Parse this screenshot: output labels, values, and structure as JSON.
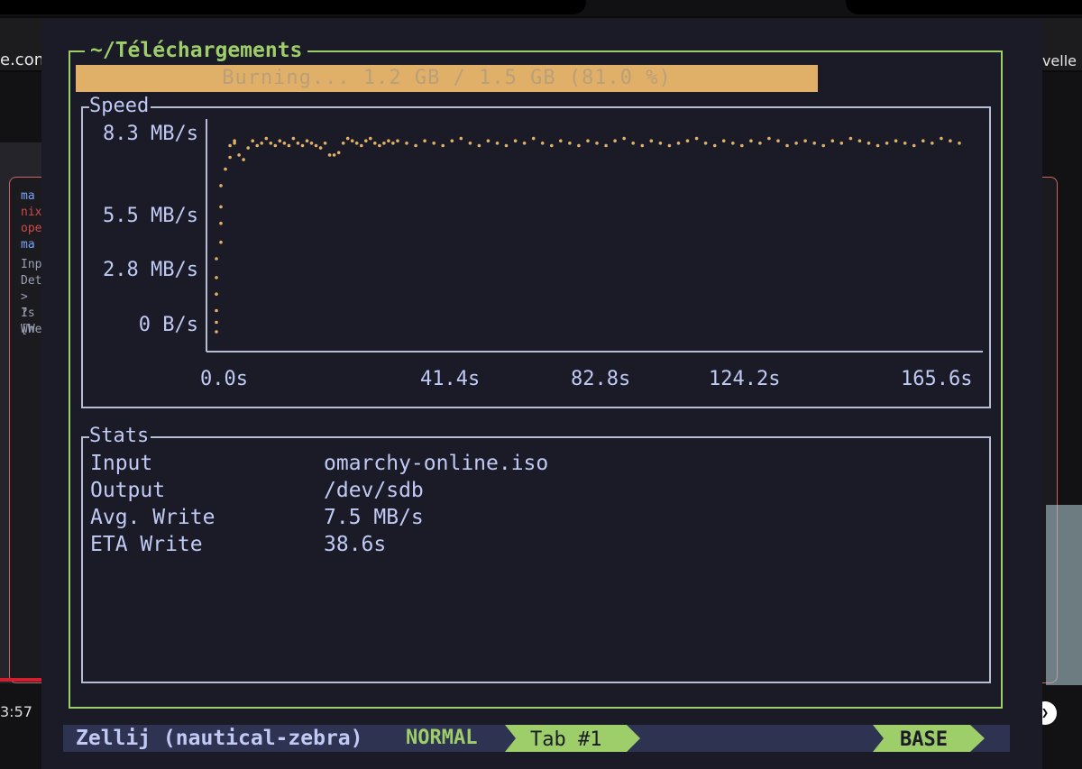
{
  "browser": {
    "url_fragment": "e.com",
    "new_tab_label": "Nouvelle",
    "video_time": "3:57",
    "sidebar_lines": [
      "ma",
      "nix",
      "oper",
      "ma",
      "Inpu",
      "Dete",
      "> Is",
      "? Wh",
      "[We"
    ]
  },
  "terminal": {
    "window_title": "~/Téléchargements",
    "progress": {
      "text": "Burning... 1.2 GB / 1.5 GB (81.0 %)",
      "fraction": 0.81
    },
    "speed_panel": {
      "title": "Speed",
      "y_ticks": [
        "8.3 MB/s",
        "5.5 MB/s",
        "2.8 MB/s",
        "0 B/s"
      ],
      "x_ticks": [
        "0.0s",
        "41.4s",
        "82.8s",
        "124.2s",
        "165.6s"
      ]
    },
    "stats_panel": {
      "title": "Stats",
      "rows": [
        {
          "key": "Input",
          "value": "omarchy-online.iso"
        },
        {
          "key": "Output",
          "value": "/dev/sdb"
        },
        {
          "key": "Avg. Write",
          "value": "7.5 MB/s"
        },
        {
          "key": "ETA Write",
          "value": "38.6s"
        }
      ]
    },
    "status_bar": {
      "session": "Zellij (nautical-zebra)",
      "mode": "NORMAL",
      "tab": "Tab #1",
      "base": "BASE"
    }
  },
  "colors": {
    "frame_accent": "#9ece6a",
    "progress_fill": "#e0af68",
    "terminal_bg": "#1a1b26",
    "text": "#c0caf5",
    "plot_points": "#e0af68"
  },
  "chart_data": {
    "type": "scatter",
    "xlabel": "",
    "ylabel": "",
    "xlim": [
      0,
      165.6
    ],
    "ylim": [
      0,
      8.3
    ],
    "x_ticks": [
      0.0,
      41.4,
      82.8,
      124.2,
      165.6
    ],
    "y_ticks": [
      0,
      2.8,
      5.5,
      8.3
    ],
    "series": [
      {
        "values_note_free": true,
        "x": [
          0,
          0,
          0,
          0,
          0,
          0,
          1,
          1,
          1,
          1,
          2,
          3,
          3,
          4,
          4,
          5,
          6,
          7,
          8,
          9,
          10,
          11,
          12,
          13,
          14,
          15,
          16,
          17,
          18,
          19,
          20,
          21,
          22,
          23,
          24,
          25,
          26,
          27,
          28,
          29,
          30,
          31,
          32,
          33,
          34,
          35,
          36,
          37,
          38,
          39,
          40,
          42,
          44,
          46,
          48,
          50,
          52,
          54,
          56,
          58,
          60,
          62,
          64,
          66,
          68,
          70,
          72,
          74,
          76,
          78,
          80,
          82,
          84,
          86,
          88,
          90,
          92,
          94,
          96,
          98,
          100,
          102,
          104,
          106,
          108,
          110,
          112,
          114,
          116,
          118,
          120,
          122,
          124,
          126,
          128,
          130,
          132,
          134,
          136,
          138,
          140,
          142,
          144,
          146,
          148,
          150,
          152,
          154,
          156,
          158,
          160,
          162,
          164
        ],
        "y": [
          0,
          0.4,
          0.9,
          1.6,
          2.3,
          3.1,
          3.8,
          4.6,
          5.3,
          6.2,
          6.9,
          7.4,
          7.9,
          8.0,
          8.1,
          7.5,
          7.3,
          7.8,
          8.1,
          7.9,
          8.0,
          8.2,
          8.0,
          7.9,
          8.1,
          8.0,
          7.9,
          8.2,
          8.0,
          7.9,
          8.1,
          8.0,
          7.9,
          7.8,
          8.0,
          7.5,
          7.5,
          7.6,
          8.0,
          8.2,
          8.1,
          8.0,
          7.9,
          8.1,
          8.2,
          8.0,
          7.9,
          8.0,
          8.1,
          8.0,
          8.1,
          8.0,
          7.9,
          8.1,
          8.0,
          7.9,
          8.1,
          8.2,
          8.0,
          7.9,
          8.1,
          8.0,
          7.9,
          8.1,
          8.0,
          8.2,
          8.0,
          7.9,
          8.1,
          8.0,
          7.9,
          8.1,
          8.0,
          7.9,
          8.1,
          8.2,
          8.0,
          7.9,
          8.1,
          8.0,
          7.9,
          8.0,
          8.1,
          8.2,
          8.0,
          7.9,
          8.1,
          8.0,
          7.9,
          8.1,
          8.0,
          8.2,
          8.1,
          7.9,
          8.0,
          8.1,
          8.0,
          7.9,
          8.1,
          8.0,
          8.2,
          8.1,
          8.0,
          7.9,
          8.0,
          8.1,
          8.0,
          7.9,
          8.1,
          8.0,
          8.2,
          8.1,
          8.0
        ]
      }
    ]
  }
}
